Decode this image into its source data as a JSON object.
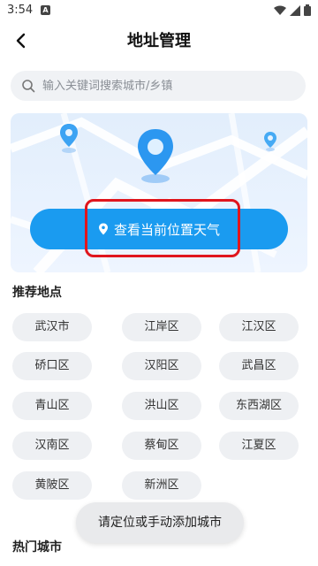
{
  "status_bar": {
    "time": "3:54",
    "notification_icon": "A"
  },
  "header": {
    "title": "地址管理"
  },
  "search": {
    "placeholder": "输入关键词搜索城市/乡镇"
  },
  "location_button": {
    "label": "查看当前位置天气"
  },
  "recommended": {
    "heading": "推荐地点",
    "items": [
      "武汉市",
      "江岸区",
      "江汉区",
      "硚口区",
      "汉阳区",
      "武昌区",
      "青山区",
      "洪山区",
      "东西湖区",
      "汉南区",
      "蔡甸区",
      "江夏区",
      "黄陂区",
      "新洲区"
    ]
  },
  "hot_cities": {
    "heading": "热门城市"
  },
  "toast": {
    "message": "请定位或手动添加城市"
  },
  "colors": {
    "accent": "#1a9bf0",
    "highlight_border": "#e0161d",
    "chip_bg": "#eef0f3"
  }
}
